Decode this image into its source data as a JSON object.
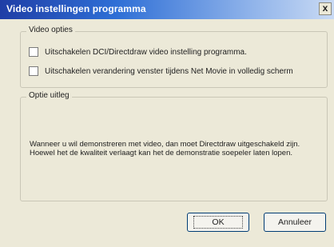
{
  "window": {
    "title": "Video instellingen programma",
    "close_glyph": "x"
  },
  "video_options": {
    "legend": "Video opties",
    "checkboxes": [
      {
        "label": "Uitschakelen DCI/Directdraw video instelling programma.",
        "checked": false
      },
      {
        "label": "Uitschakelen verandering venster tijdens Net Movie in volledig scherm",
        "checked": false
      }
    ]
  },
  "explanation": {
    "legend": "Optie uitleg",
    "text": "Wanneer u wil demonstreren met video, dan moet Directdraw uitgeschakeld zijn. Hoewel het de kwaliteit verlaagt kan het de demonstratie soepeler laten lopen."
  },
  "buttons": {
    "ok_label": "OK",
    "cancel_label": "Annuleer"
  },
  "colors": {
    "title_gradient_start": "#1f3ea6",
    "title_gradient_end": "#c9daf4",
    "dialog_background": "#ece9d8"
  }
}
